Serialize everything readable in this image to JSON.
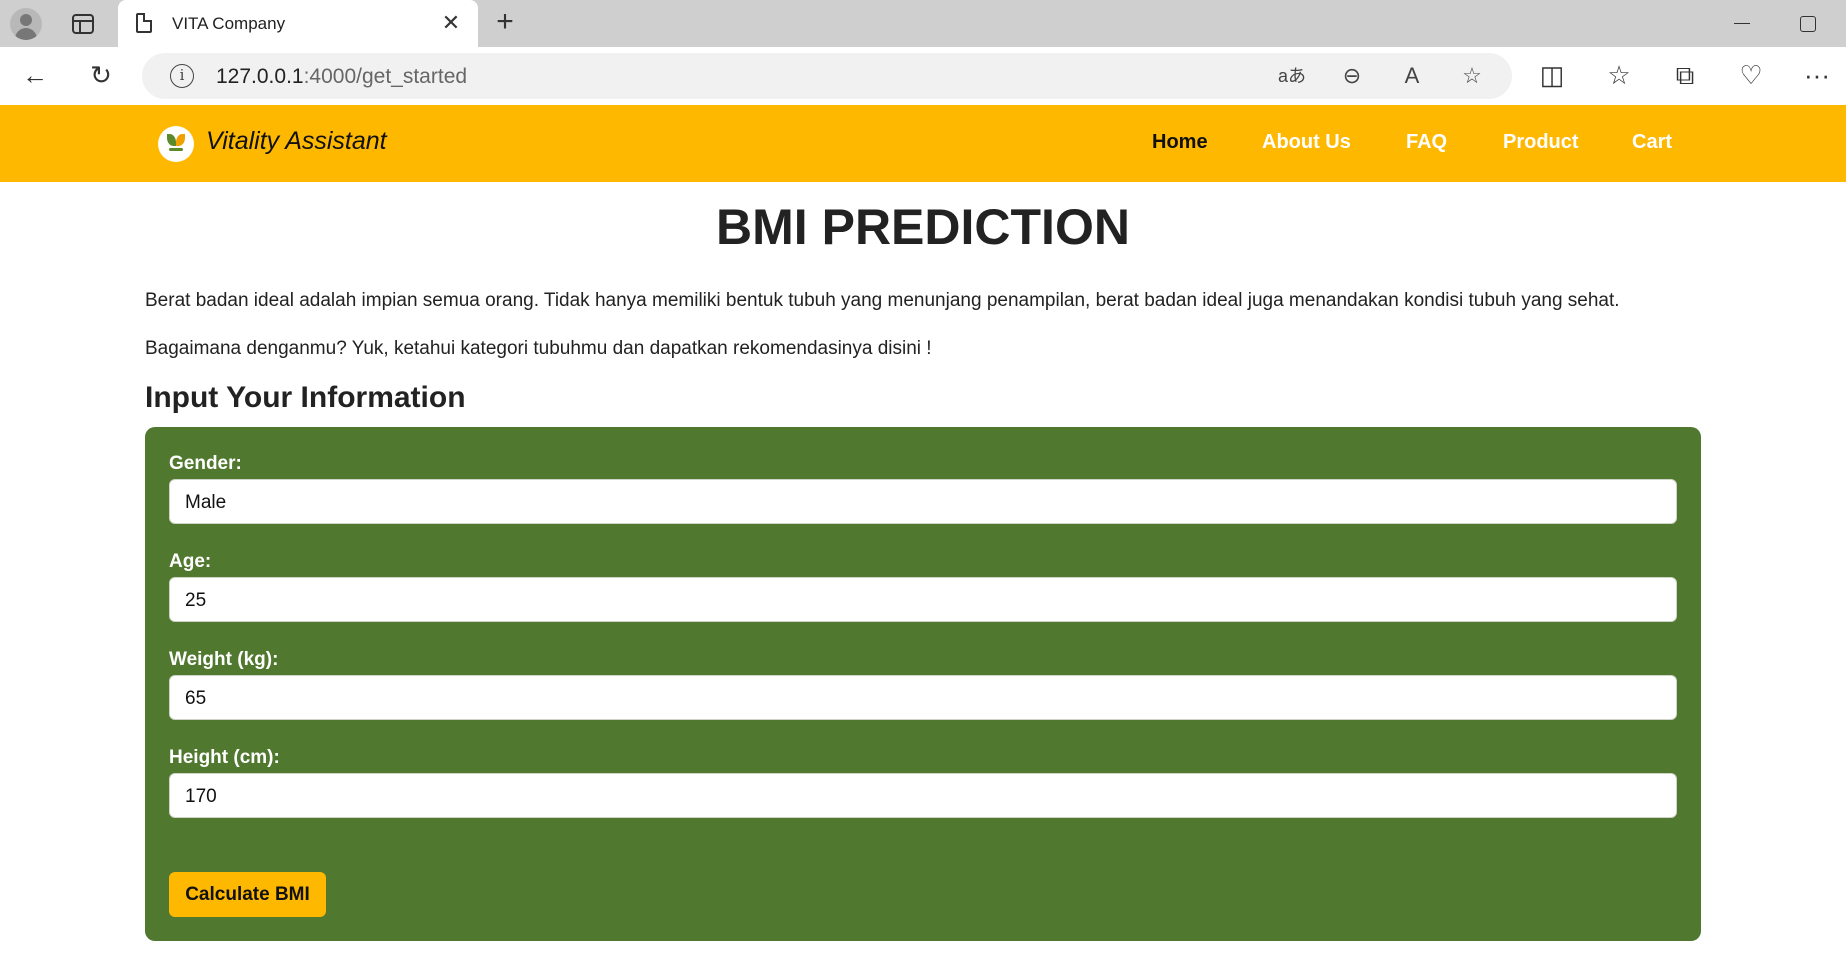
{
  "browser": {
    "tab_title": "VITA Company",
    "tab_close": "✕",
    "new_tab": "+",
    "url_host": "127.0.0.1",
    "url_path": ":4000/get_started",
    "icons": {
      "back": "←",
      "reload": "↻",
      "translate": "aあ",
      "zoom_out": "⊖",
      "read_aloud": "A",
      "favorite": "☆",
      "split_screen": "◫",
      "favorites": "☆",
      "collections": "⧉",
      "health": "♡",
      "menu": "···"
    }
  },
  "nav": {
    "brand": "Vitality Assistant",
    "links": [
      "Home",
      "About Us",
      "FAQ",
      "Product",
      "Cart"
    ],
    "active": "Home",
    "bar_color": "#FFB800"
  },
  "main": {
    "title": "BMI PREDICTION",
    "intro_1": "Berat badan ideal adalah impian semua orang. Tidak hanya memiliki bentuk tubuh yang menunjang penampilan, berat badan ideal juga menandakan kondisi tubuh yang sehat.",
    "intro_2": "Bagaimana denganmu? Yuk, ketahui kategori tubuhmu dan dapatkan rekomendasinya disini !",
    "section_heading": "Input Your Information"
  },
  "form": {
    "card_color": "#50782E",
    "gender_label": "Gender:",
    "gender_value": "Male",
    "age_label": "Age:",
    "age_value": "25",
    "weight_label": "Weight (kg):",
    "weight_value": "65",
    "height_label": "Height (cm):",
    "height_value": "170",
    "submit_label": "Calculate BMI"
  }
}
